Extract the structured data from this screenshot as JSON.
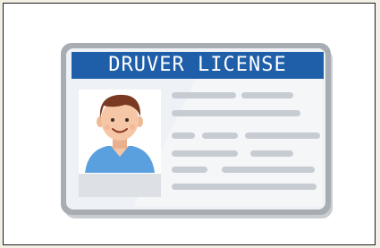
{
  "card": {
    "title": "DRUVER LICENSE",
    "colors": {
      "header": "#1f5ea8",
      "card_face": "#eef1f5",
      "card_border": "#9aa0a8",
      "placeholder_line": "#c7ccd3",
      "photo_bg": "#ffffff",
      "shirt": "#5aa0de",
      "hair": "#7a3a22",
      "skin": "#f6c7a6"
    }
  },
  "icons": [
    "portrait-photo-icon"
  ]
}
